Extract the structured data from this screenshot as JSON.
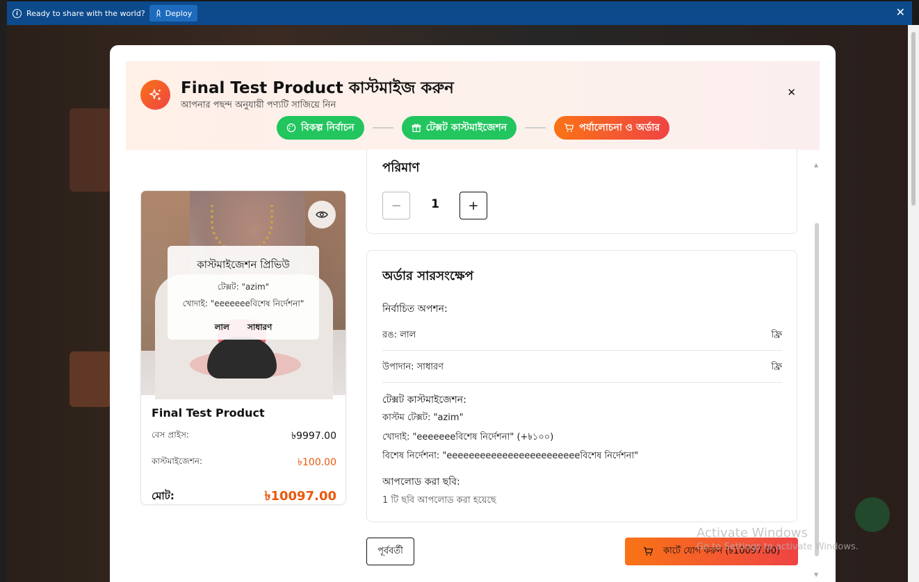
{
  "banner": {
    "message": "Ready to share with the world?",
    "deploy_label": "Deploy"
  },
  "modal": {
    "title": "Final Test Product কাস্টমাইজ করুন",
    "subtitle": "আপনার পছন্দ অনুযায়ী পণ্যটি সাজিয়ে নিন",
    "steps": [
      {
        "label": "বিকল্প নির্বাচন",
        "state": "done"
      },
      {
        "label": "টেক্সট কাস্টমাইজেশন",
        "state": "done"
      },
      {
        "label": "পর্যালোচনা ও অর্ডার",
        "state": "active"
      }
    ]
  },
  "preview": {
    "overlay_title": "কাস্টমাইজেশন প্রিভিউ",
    "overlay_text_line": "টেক্সট: \"azim\"",
    "overlay_engrave_line": "খোদাই: \"eeeeeeeবিশেষ নির্দেশনা\"",
    "tag_color": "লাল",
    "tag_material": "সাধারণ",
    "product_name": "Final Test Product",
    "base_price_label": "বেস প্রাইস:",
    "base_price_value": "৳9997.00",
    "customization_label": "কাস্টমাইজেশন:",
    "customization_value": "৳100.00",
    "total_label": "মোট:",
    "total_value": "৳10097.00"
  },
  "quantity": {
    "title": "পরিমাণ",
    "value": "1",
    "minus": "−",
    "plus": "+"
  },
  "summary": {
    "title": "অর্ডার সারসংক্ষেপ",
    "selected_options_label": "নির্বাচিত অপশন:",
    "options": [
      {
        "label": "রঙ: লাল",
        "price": "ফ্রি"
      },
      {
        "label": "উপাদান: সাধারণ",
        "price": "ফ্রি"
      }
    ],
    "text_custom_label": "টেক্সট কাস্টমাইজেশন:",
    "custom_text_line": "কাস্টম টেক্সট: \"azim\"",
    "engraving_line": "খোদাই: \"eeeeeeeবিশেষ নির্দেশনা\" (+৳১০০)",
    "special_line": "বিশেষ নির্দেশনা: \"eeeeeeeeeeeeeeeeeeeeeeeeবিশেষ নির্দেশনা\"",
    "uploaded_label": "আপলোড করা ছবি:",
    "uploaded_value": "1 টি ছবি আপলোড করা হয়েছে"
  },
  "actions": {
    "prev_label": "পূর্ববর্তী",
    "cart_label": "কার্টে যোগ করুন (৳10097.00)"
  },
  "watermark": {
    "line1": "Activate Windows",
    "line2": "Go to Settings to activate Windows."
  },
  "colors": {
    "accent_orange": "#f97316",
    "accent_red": "#ef4444",
    "step_done_green": "#22c55e",
    "banner_blue": "#0d4a8c"
  }
}
